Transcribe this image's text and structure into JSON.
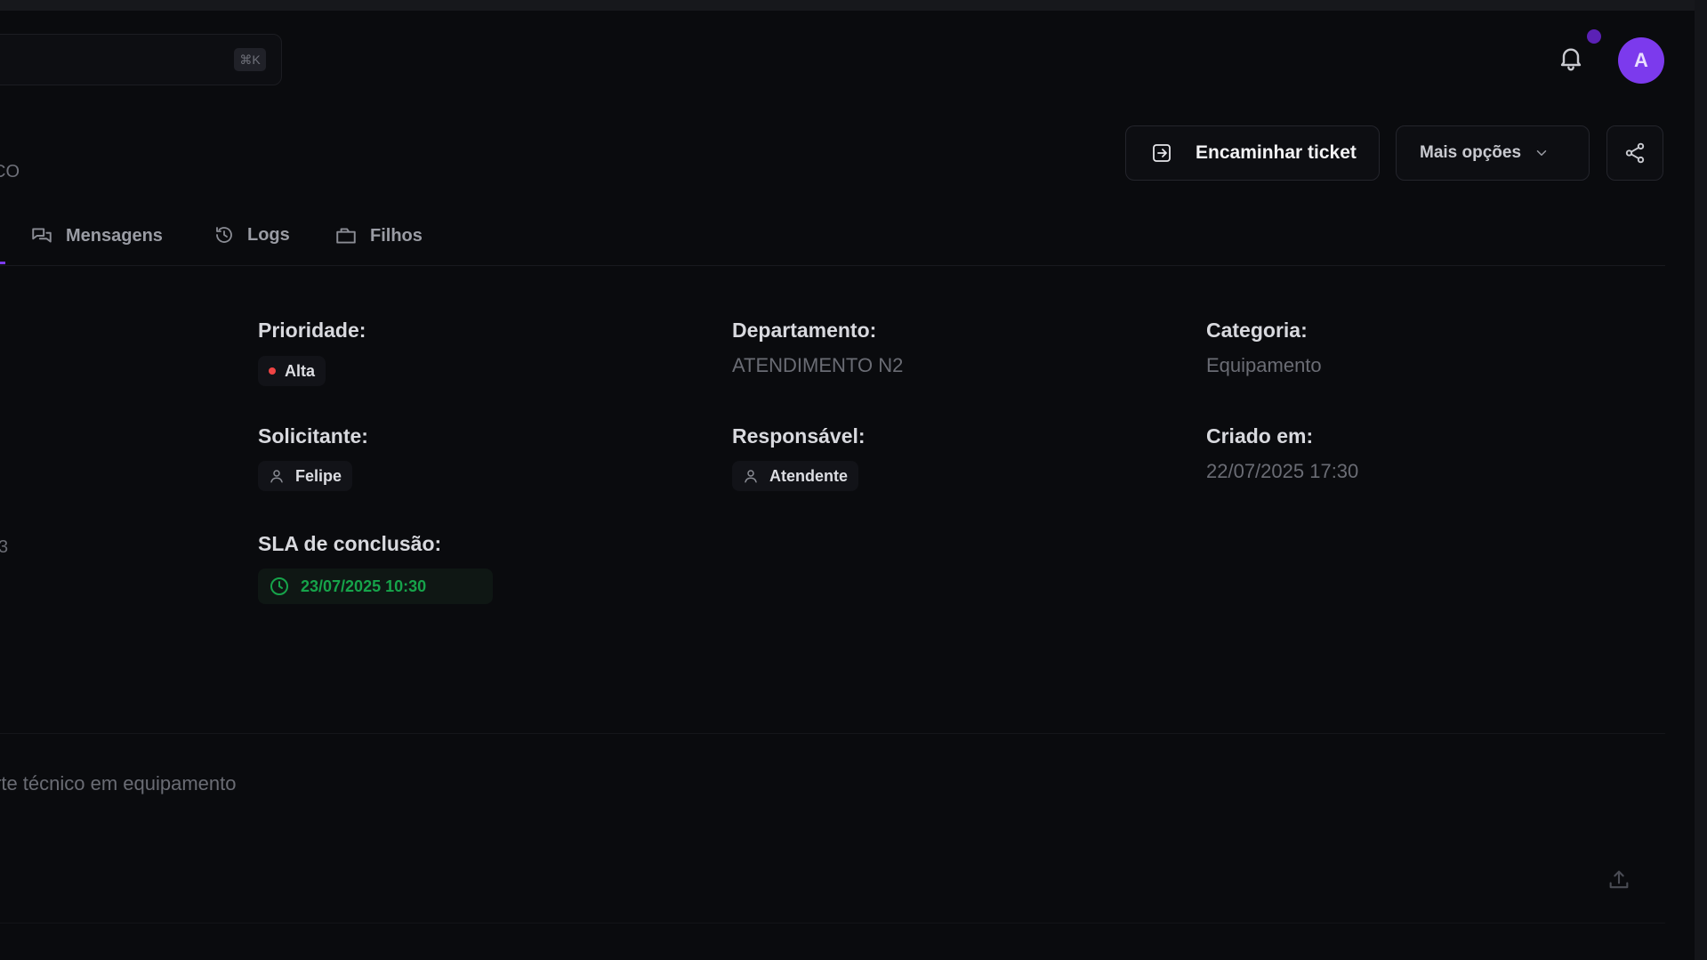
{
  "header": {
    "search_shortcut": "⌘K",
    "avatar_initial": "A"
  },
  "ticket": {
    "subtitle_partial": "CO",
    "actions": {
      "forward_label": "Encaminhar ticket",
      "more_label": "Mais opções"
    },
    "tabs": [
      {
        "label": "Mensagens",
        "icon": "messages-icon"
      },
      {
        "label": "Logs",
        "icon": "history-icon"
      },
      {
        "label": "Filhos",
        "icon": "folder-icon"
      }
    ],
    "fields": {
      "priority": {
        "label": "Prioridade:",
        "value": "Alta"
      },
      "department": {
        "label": "Departamento:",
        "value": "ATENDIMENTO N2"
      },
      "category": {
        "label": "Categoria:",
        "value": "Equipamento"
      },
      "requester": {
        "label": "Solicitante:",
        "value": "Felipe"
      },
      "assignee": {
        "label": "Responsável:",
        "value": "Atendente"
      },
      "created": {
        "label": "Criado em:",
        "value": "22/07/2025 17:30"
      },
      "sla": {
        "label": "SLA de conclusão:",
        "value": "23/07/2025 10:30"
      }
    },
    "left_stub": "3",
    "description_partial": "rte técnico em equipamento"
  },
  "colors": {
    "background": "#0a0b0e",
    "accent": "#7c3aed",
    "priority_high": "#ef4444",
    "sla_ok": "#16a34a"
  }
}
